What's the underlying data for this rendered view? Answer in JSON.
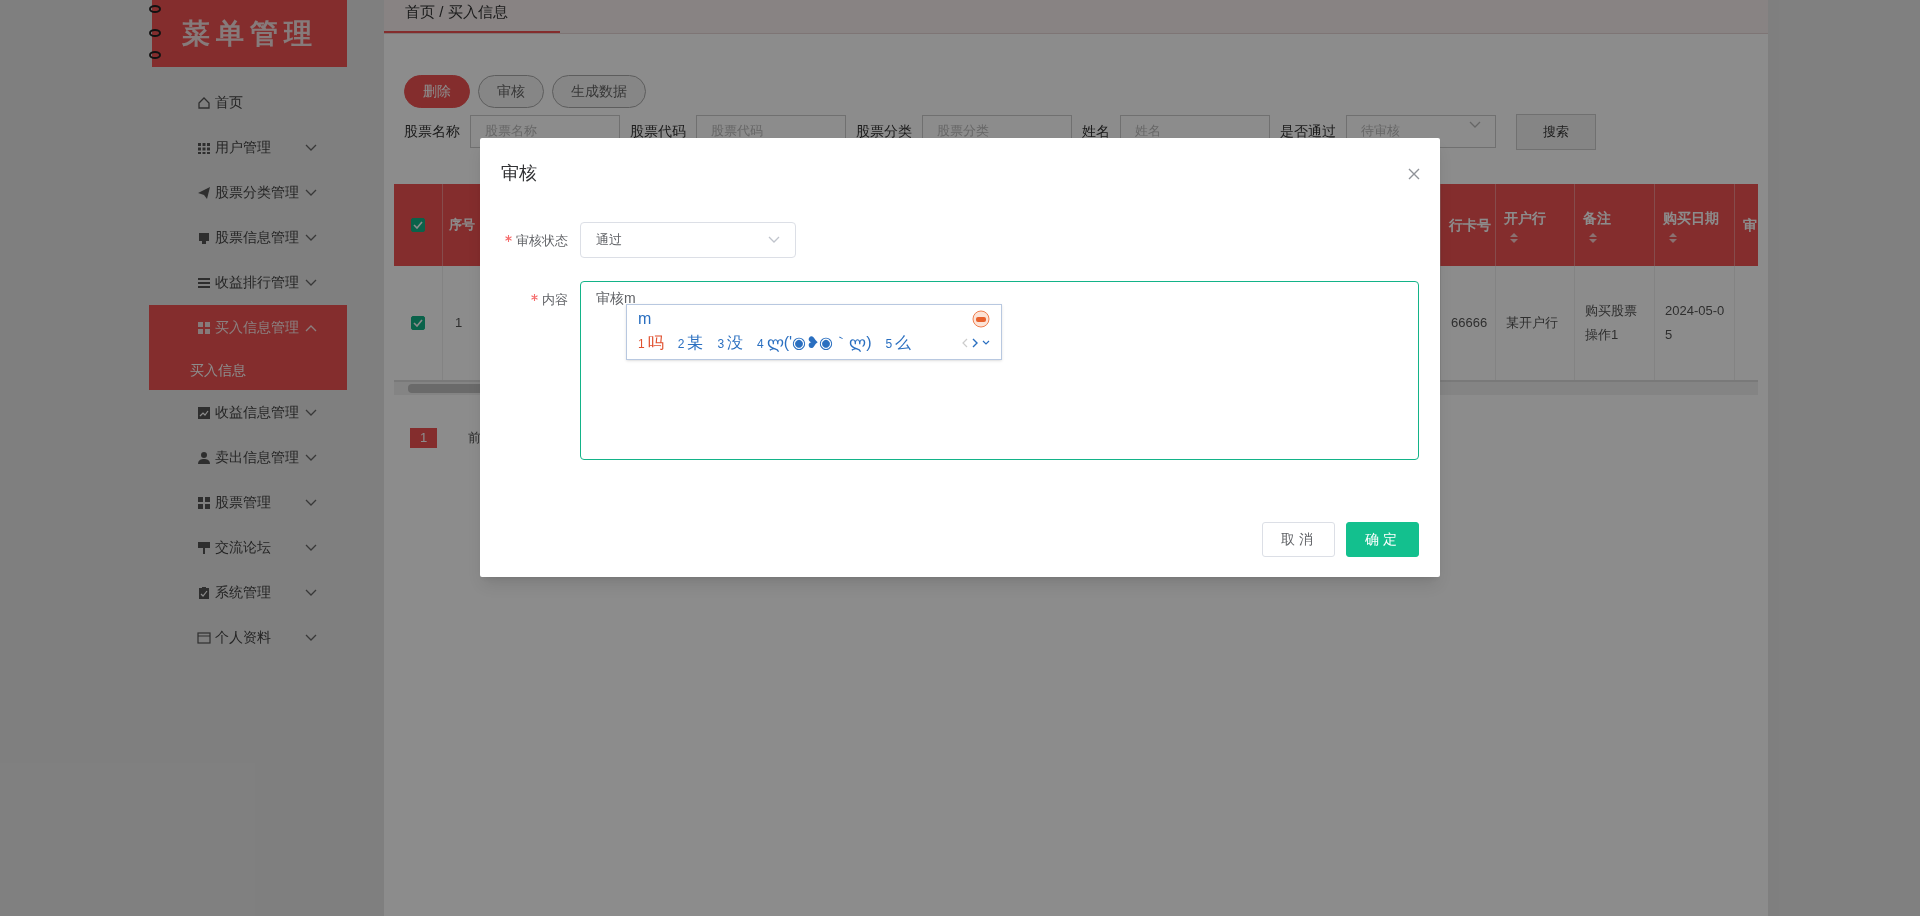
{
  "sidebar": {
    "logo": "菜单管理",
    "items": [
      {
        "label": "首页",
        "kind": "link"
      },
      {
        "label": "用户管理",
        "kind": "group",
        "expanded": false
      },
      {
        "label": "股票分类管理",
        "kind": "group",
        "expanded": false
      },
      {
        "label": "股票信息管理",
        "kind": "group",
        "expanded": false
      },
      {
        "label": "收益排行管理",
        "kind": "group",
        "expanded": false
      },
      {
        "label": "买入信息管理",
        "kind": "group",
        "expanded": true,
        "children": [
          {
            "label": "买入信息",
            "selected": true
          }
        ]
      },
      {
        "label": "收益信息管理",
        "kind": "group",
        "expanded": false
      },
      {
        "label": "卖出信息管理",
        "kind": "group",
        "expanded": false
      },
      {
        "label": "股票管理",
        "kind": "group",
        "expanded": false
      },
      {
        "label": "交流论坛",
        "kind": "group",
        "expanded": false
      },
      {
        "label": "系统管理",
        "kind": "group",
        "expanded": false
      },
      {
        "label": "个人资料",
        "kind": "group",
        "expanded": false
      }
    ]
  },
  "breadcrumb": "首页 / 买入信息",
  "toolbar": [
    {
      "label": "删除",
      "kind": "danger"
    },
    {
      "label": "审核",
      "kind": "default"
    },
    {
      "label": "生成数据",
      "kind": "default"
    }
  ],
  "search": {
    "fields": [
      {
        "label": "股票名称",
        "placeholder": "股票名称",
        "kind": "input"
      },
      {
        "label": "股票代码",
        "placeholder": "股票代码",
        "kind": "input"
      },
      {
        "label": "股票分类",
        "placeholder": "股票分类",
        "kind": "input"
      },
      {
        "label": "姓名",
        "placeholder": "姓名",
        "kind": "input"
      },
      {
        "label": "是否通过",
        "placeholder": "待审核",
        "kind": "select"
      }
    ],
    "button": "搜索"
  },
  "table": {
    "header_checked": true,
    "left_columns": [
      "序号"
    ],
    "right_columns": [
      {
        "label": "行卡号",
        "sortable": false
      },
      {
        "label": "开户行",
        "sortable": true
      },
      {
        "label": "备注",
        "sortable": true
      },
      {
        "label": "购买日期",
        "sortable": true
      },
      {
        "label": "审",
        "sortable": false
      }
    ],
    "rows": [
      {
        "checked": true,
        "left_cells": [
          "1"
        ],
        "right_cells": [
          "66666",
          "某开户行",
          "购买股票操作1",
          "2024-05-05",
          ""
        ]
      }
    ]
  },
  "pagination": {
    "current": "1",
    "label": "前"
  },
  "dialog": {
    "title": "审核",
    "fields": [
      {
        "label": "审核状态",
        "required": true,
        "kind": "select",
        "value": "通过"
      },
      {
        "label": "内容",
        "required": true,
        "kind": "textarea",
        "value": "审核m"
      }
    ],
    "ime": {
      "composition": "m",
      "candidates": [
        {
          "index": "1",
          "text": "吗",
          "selected": true
        },
        {
          "index": "2",
          "text": "某",
          "selected": false
        },
        {
          "index": "3",
          "text": "没",
          "selected": false
        },
        {
          "index": "4",
          "text": "ლ('◉❥◉｀ლ)",
          "selected": false
        },
        {
          "index": "5",
          "text": "么",
          "selected": false
        }
      ]
    },
    "buttons": [
      {
        "label": "取消",
        "kind": "default"
      },
      {
        "label": "确定",
        "kind": "primary"
      }
    ]
  }
}
